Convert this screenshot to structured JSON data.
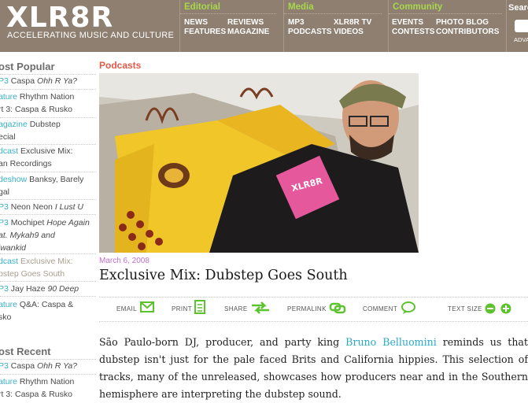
{
  "header": {
    "logo": "XLR8R",
    "tagline": "ACCELERATING MUSIC AND CULTURE",
    "nav": [
      {
        "heading": "Editorial",
        "items": [
          "NEWS",
          "REVIEWS",
          "FEATURES",
          "MAGAZINE"
        ]
      },
      {
        "heading": "Media",
        "items": [
          "MP3",
          "XLR8R TV",
          "PODCASTS",
          "VIDEOS"
        ]
      },
      {
        "heading": "Community",
        "items": [
          "EVENTS",
          "PHOTO BLOG",
          "CONTESTS",
          "CONTRIBUTORS"
        ]
      }
    ],
    "search_label": "Searc",
    "advanced": "ADVA"
  },
  "sidebar": {
    "most_popular_heading": "ost Popular",
    "most_popular": [
      {
        "cat": "P3",
        "text": " Caspa ",
        "italic": "Ohh R Ya?"
      },
      {
        "cat": "ature",
        "text": " Rhythm Nation",
        "line2": "rt 3: Caspa & Rusko"
      },
      {
        "cat": "agazine",
        "text": " Dubstep",
        "line2": "ecial"
      },
      {
        "cat": "dcast",
        "text": " Exclusive Mix:",
        "line2": "an Recordings"
      },
      {
        "cat": "deshow",
        "text": " Banksy, Barely",
        "line2": "gal"
      },
      {
        "cat": "P3",
        "text": " Neon Neon ",
        "italic": "I Lust U"
      },
      {
        "cat": "P3",
        "text": " Mochipet ",
        "italic": "Hope Again",
        "line2i": "at. Mykah9 and",
        "line3i": "iwankid"
      },
      {
        "cat": "dcast",
        "text": " Exclusive Mix:",
        "line2": "bstep Goes South",
        "visited": true
      },
      {
        "cat": "P3",
        "text": " Jay Haze ",
        "italic": "90 Deep"
      },
      {
        "cat": "ature",
        "text": " Q&A: Caspa &",
        "line2": "sko"
      }
    ],
    "most_recent_heading": "ost Recent",
    "most_recent": [
      {
        "cat": "P3",
        "text": " Caspa ",
        "italic": "Ohh R Ya?"
      },
      {
        "cat": "ature",
        "text": " Rhythm Nation",
        "line2": "rt 3: Caspa & Rusko"
      }
    ]
  },
  "article": {
    "section": "Podcasts",
    "date": "March 6, 2008",
    "title": "Exclusive Mix: Dubstep Goes South",
    "tools": {
      "email": "EMAIL",
      "print": "PRINT",
      "share": "SHARE",
      "permalink": "PERMALINK",
      "comment": "COMMENT",
      "text_size": "TEXT SIZE"
    },
    "body_pre": "São Paulo-born DJ, producer, and party king ",
    "body_link": "Bruno Belluomini",
    "body_post": " reminds us that dubstep isn't just for the pale faced Brits and California hippies. This selection of tracks, many of the unreleased, showcases how producers near and in the Southern hemisphere are interpreting the dubstep sound.",
    "shirt_text": "XLR8R"
  },
  "colors": {
    "header_bg": "#8e7f70",
    "nav_heading": "#a6d84d",
    "section": "#e35a48",
    "link": "#2aa9c9",
    "date": "#c16fd0",
    "tool_icon": "#5cc22e"
  }
}
